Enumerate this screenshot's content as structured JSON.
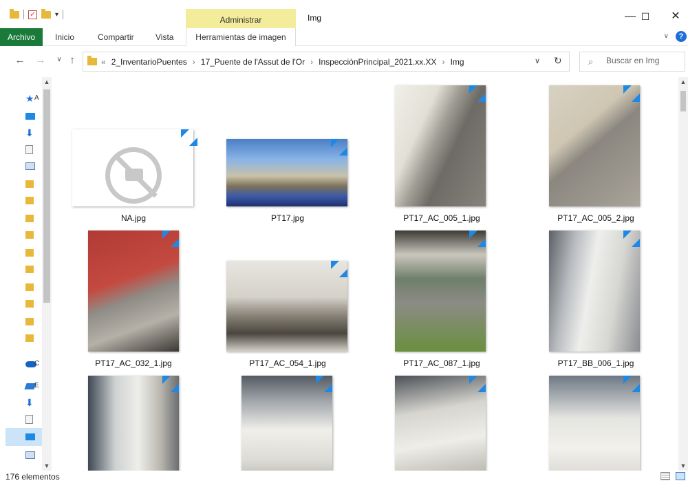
{
  "window": {
    "title": "Img",
    "contextual_tab_group": "Administrar",
    "controls": {
      "minimize": "—",
      "maximize": "☐",
      "close": "✕"
    }
  },
  "ribbon": {
    "tabs": [
      "Archivo",
      "Inicio",
      "Compartir",
      "Vista",
      "Herramientas de imagen"
    ],
    "expand_glyph": "∨",
    "help_glyph": "?"
  },
  "navigation": {
    "back": "←",
    "forward": "→",
    "recent": "∨",
    "up": "↑",
    "breadcrumb": {
      "overflow": "«",
      "items": [
        "2_InventarioPuentes",
        "17_Puente de l'Assut de l'Or",
        "InspecciónPrincipal_2021.xx.XX",
        "Img"
      ],
      "separator": "›"
    },
    "dropdown": "∨",
    "refresh": "↻"
  },
  "search": {
    "placeholder": "Buscar en Img",
    "value": ""
  },
  "sidebar": {
    "items": [
      {
        "icon": "star-icon",
        "label_visible": "A"
      },
      {
        "icon": "desktop-icon"
      },
      {
        "icon": "download-icon"
      },
      {
        "icon": "document-icon"
      },
      {
        "icon": "picture-icon"
      },
      {
        "icon": "folder-icon"
      },
      {
        "icon": "folder-icon"
      },
      {
        "icon": "folder-icon"
      },
      {
        "icon": "folder-icon"
      },
      {
        "icon": "folder-icon"
      },
      {
        "icon": "folder-icon"
      },
      {
        "icon": "folder-icon"
      },
      {
        "icon": "folder-icon"
      },
      {
        "icon": "folder-icon"
      },
      {
        "icon": "folder-icon"
      },
      {
        "icon": "onedrive-icon",
        "label_visible": "C"
      },
      {
        "icon": "this-pc-icon",
        "label_visible": "E"
      },
      {
        "icon": "download-icon"
      },
      {
        "icon": "document-icon"
      },
      {
        "icon": "desktop-icon"
      },
      {
        "icon": "picture-icon"
      }
    ]
  },
  "files": [
    {
      "name": "NA.jpg",
      "kind": "placeholder"
    },
    {
      "name": "PT17.jpg",
      "kind": "landscape"
    },
    {
      "name": "PT17_AC_005_1.jpg",
      "kind": "portrait"
    },
    {
      "name": "PT17_AC_005_2.jpg",
      "kind": "portrait"
    },
    {
      "name": "PT17_AC_032_1.jpg",
      "kind": "portrait"
    },
    {
      "name": "PT17_AC_054_1.jpg",
      "kind": "landscape"
    },
    {
      "name": "PT17_AC_087_1.jpg",
      "kind": "portrait"
    },
    {
      "name": "PT17_BB_006_1.jpg",
      "kind": "portrait"
    },
    {
      "name": "",
      "kind": "portrait"
    },
    {
      "name": "",
      "kind": "portrait"
    },
    {
      "name": "",
      "kind": "portrait"
    },
    {
      "name": "",
      "kind": "portrait"
    }
  ],
  "status": {
    "item_count": "176 elementos"
  },
  "colors": {
    "file_tab": "#1a7a3a",
    "contextual_tab": "#f3ec9a",
    "accent": "#1e88e5",
    "selection": "#cce4f7"
  }
}
